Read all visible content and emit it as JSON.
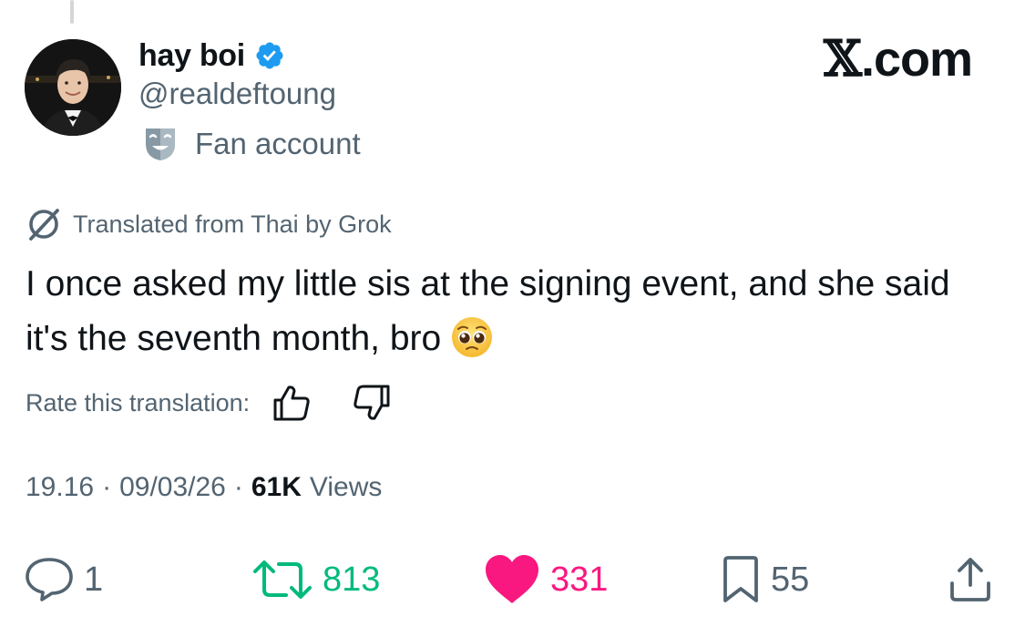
{
  "profile": {
    "display_name": "hay boi",
    "handle": "@realdeftoung",
    "label": "Fan account",
    "avatar_icon": "avatar-photo",
    "verified_icon": "verified-badge-icon",
    "verified_color": "#1d9bf0"
  },
  "brand": {
    "x": "𝕏",
    "domain": ".com"
  },
  "translation": {
    "notice": "Translated from Thai by Grok",
    "icon": "grok-icon",
    "rate_label": "Rate this translation:",
    "thumbs_up_icon": "thumbs-up-icon",
    "thumbs_down_icon": "thumbs-down-icon"
  },
  "tweet": {
    "text": "I once asked my little sis at the signing event, and she said it's the seventh month, bro",
    "emoji": "pleading-face-emoji",
    "time": "19.16",
    "date": "09/03/26",
    "views_count": "61K",
    "views_label": "Views",
    "separator": "·"
  },
  "actions": {
    "replies": "1",
    "retweets": "813",
    "likes": "331",
    "bookmarks": "55"
  },
  "colors": {
    "text": "#0f1419",
    "secondary": "#536471",
    "retweet": "#00ba7c",
    "like": "#f91880"
  }
}
